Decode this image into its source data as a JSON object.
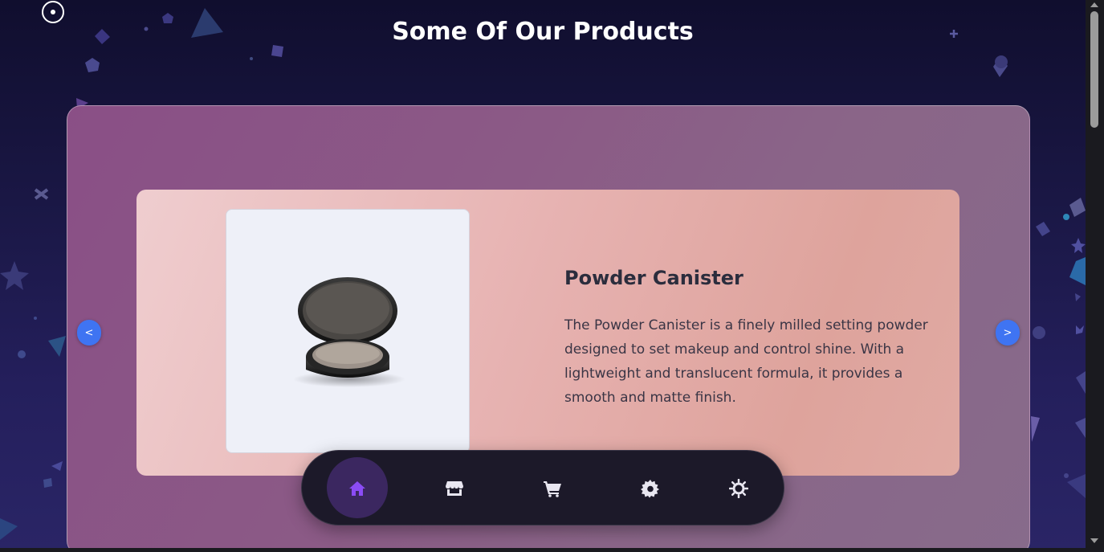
{
  "page": {
    "title": "Some Of Our Products"
  },
  "product": {
    "name": "Powder Canister",
    "description": "The Powder Canister is a finely milled setting powder designed to set makeup and control shine. With a lightweight and translucent formula, it provides a smooth and matte finish.",
    "image_icon": "compact-powder-image"
  },
  "carousel": {
    "prev_label": "<",
    "next_label": ">"
  },
  "bottom_nav": {
    "items": [
      {
        "icon": "home-icon",
        "active": true
      },
      {
        "icon": "store-icon",
        "active": false
      },
      {
        "icon": "cart-icon",
        "active": false
      },
      {
        "icon": "settings-icon",
        "active": false
      },
      {
        "icon": "sun-icon",
        "active": false
      }
    ]
  },
  "colors": {
    "accent": "#3f74f2",
    "active_icon": "#8b4cf5",
    "nav_bg": "#1c1929",
    "text_dark": "#2b2d3d"
  }
}
